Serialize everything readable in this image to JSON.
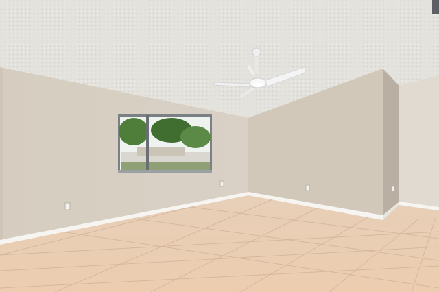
{
  "scene": {
    "description_visible_text": "",
    "colors": {
      "ceiling": "#e6e4df",
      "wall_left": "#d8d0c4",
      "wall_center": "#d3cabd",
      "wall_right": "#e0dad2",
      "floor": "#e9cdb4",
      "grout": "#cfae94",
      "baseboard": "#f6f4f0",
      "fan": "#f2f2f2",
      "window_frame": "#6a6f73",
      "foliage": "#4d7d3a",
      "sky": "#f2f6f4"
    },
    "objects": [
      "ceiling-fan",
      "window",
      "electrical-outlet",
      "tile-floor",
      "baseboard"
    ]
  }
}
